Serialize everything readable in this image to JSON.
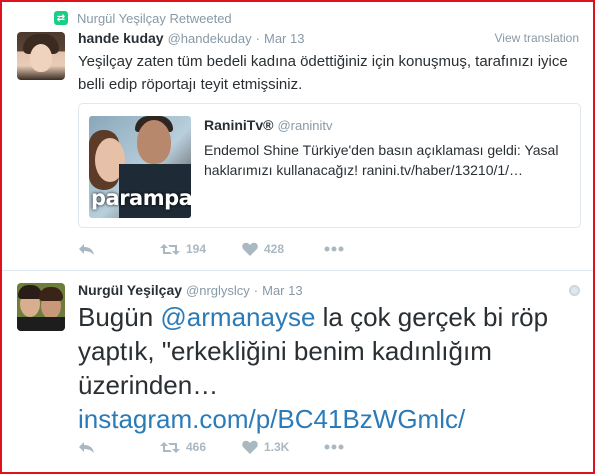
{
  "retweet_header": {
    "label": "Nurgül Yeşilçay Retweeted"
  },
  "tweet1": {
    "fullname": "hande kuday",
    "handle": "@handekuday",
    "dot": "·",
    "time": "Mar 13",
    "view_translation": "View translation",
    "text": "Yeşilçay zaten tüm bedeli kadına ödettiğiniz için konuşmuş, tarafınızı iyice belli edip röportajı teyit etmişsiniz.",
    "card": {
      "name": "RaniniTv®",
      "handle": "@raninitv",
      "text": "Endemol Shine Türkiye'den basın açıklaması geldi: Yasal haklarımızı kullanacağız! ranini.tv/haber/13210/1/…",
      "image_logo": "parampa"
    },
    "actions": {
      "retweets": "194",
      "likes": "428"
    }
  },
  "tweet2": {
    "fullname": "Nurgül Yeşilçay",
    "handle": "@nrglyslcy",
    "dot": "·",
    "time": "Mar 13",
    "text_before": "Bugün ",
    "mention": "@armanayse",
    "text_after": " la çok gerçek bi röp yaptık, \"erkekliğini benim kadınlığım üzerinden…",
    "link": "instagram.com/p/BC41BzWGmlc/",
    "actions": {
      "retweets": "466",
      "likes": "1.3K"
    }
  },
  "colors": {
    "frame_border": "#e0101c",
    "link": "#2b7bb9",
    "muted": "#8899a6",
    "retweet_green": "#19cf86"
  },
  "icons": [
    "retweet-badge-icon",
    "reply-icon",
    "retweet-icon",
    "heart-icon",
    "more-icon",
    "globe-icon"
  ]
}
